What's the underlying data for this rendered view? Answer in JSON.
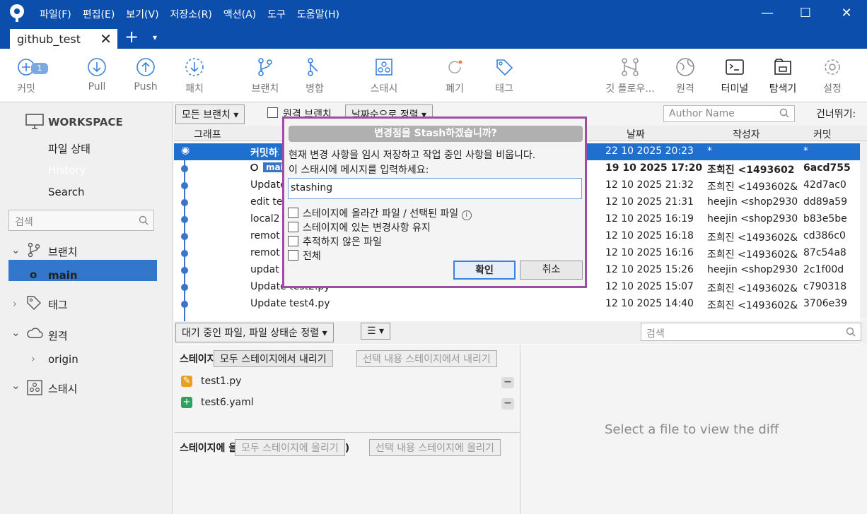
{
  "menu": [
    "파일(F)",
    "편집(E)",
    "보기(V)",
    "저장소(R)",
    "액션(A)",
    "도구",
    "도움말(H)"
  ],
  "tab": {
    "title": "github_test",
    "close": "✕",
    "plus": "+",
    "dropdown": "▾"
  },
  "window": {
    "minimize": "—",
    "maximize": "☐",
    "close": "✕"
  },
  "toolbar": {
    "commit": "커밋",
    "commit_badge": "1",
    "pull": "Pull",
    "push": "Push",
    "fetch": "패치",
    "branch": "브랜치",
    "merge": "병합",
    "stash": "스태시",
    "discard": "폐기",
    "tag": "태그",
    "gitflow": "깃 플로우...",
    "remote": "원격",
    "terminal": "터미널",
    "explorer": "탐색기",
    "settings": "설정"
  },
  "sidebar": {
    "workspace": "WORKSPACE",
    "file_status": "파일 상태",
    "history": "History",
    "search": "Search",
    "search_placeholder": "검색",
    "branches": "브랜치",
    "main": "main",
    "tags": "태그",
    "remotes": "원격",
    "origin": "origin",
    "stashes": "스태시"
  },
  "filters": {
    "all_branches": "모든 브랜치 ▾",
    "remote_branch": "원격 브랜치",
    "date_order": "날짜순으로 정렬 ▾",
    "author_placeholder": "Author Name",
    "skip": "건너뛰기:"
  },
  "columns": {
    "graph": "그래프",
    "date": "날짜",
    "author": "작성자",
    "commit": "커밋"
  },
  "rows": [
    {
      "desc": "커밋하지 않은 변경사항",
      "date": "22 10 2025 20:23",
      "author": "*",
      "commit": "*"
    },
    {
      "desc": "main",
      "date": "19 10 2025 17:20",
      "author": "조희진 <1493602",
      "commit": "6acd755"
    },
    {
      "desc": "Update",
      "date": "12 10 2025 21:32",
      "author": "조희진 <1493602&",
      "commit": "42d7ac0"
    },
    {
      "desc": "edit te",
      "date": "12 10 2025 21:31",
      "author": "heejin <shop2930",
      "commit": "dd89a59"
    },
    {
      "desc": "local2",
      "date": "12 10 2025 16:19",
      "author": "heejin <shop2930",
      "commit": "b83e5be"
    },
    {
      "desc": "remot",
      "date": "12 10 2025 16:18",
      "author": "조희진 <1493602&",
      "commit": "cd386c0"
    },
    {
      "desc": "remot",
      "date": "12 10 2025 16:16",
      "author": "조희진 <1493602&",
      "commit": "87c54a8"
    },
    {
      "desc": "updat",
      "date": "12 10 2025 15:26",
      "author": "heejin <shop2930",
      "commit": "2c1f00d"
    },
    {
      "desc": "Update test2.py",
      "date": "12 10 2025 15:07",
      "author": "조희진 <1493602&",
      "commit": "c790318"
    },
    {
      "desc": "Update test4.py",
      "date": "12 10 2025 14:40",
      "author": "조희진 <1493602&",
      "commit": "3706e39"
    }
  ],
  "lower": {
    "sort": "대기 중인 파일, 파일 상태순 정렬 ▾",
    "view": "☰ ▾",
    "search_placeholder": "검색",
    "staged_label": "스테이지",
    "unstage_all": "모두 스테이지에서 내리기",
    "unstage_sel": "선택 내용 스테이지에서 내리기",
    "files": [
      "test1.py",
      "test6.yaml"
    ],
    "unstaged_label": "스테이지에 올라가지 않은 파일 (0 파일)",
    "stage_all": "모두 스테이지에 올리기",
    "stage_sel": "선택 내용 스테이지에 올리기",
    "diff_placeholder": "Select a file to view the diff"
  },
  "dialog": {
    "title": "변경점을 Stash하겠습니까?",
    "line1": "현재 변경 사항을 임시 저장하고 작업 중인 사항을 비웁니다.",
    "line2": "이 스태시에 메시지를 입력하세요:",
    "message": "stashing",
    "opt1": "스테이지에 올라간 파일 / 선택된 파일",
    "opt2": "스테이지에 있는 변경사항 유지",
    "opt3": "추적하지 않은 파일",
    "opt4": "전체",
    "ok": "확인",
    "cancel": "취소"
  }
}
